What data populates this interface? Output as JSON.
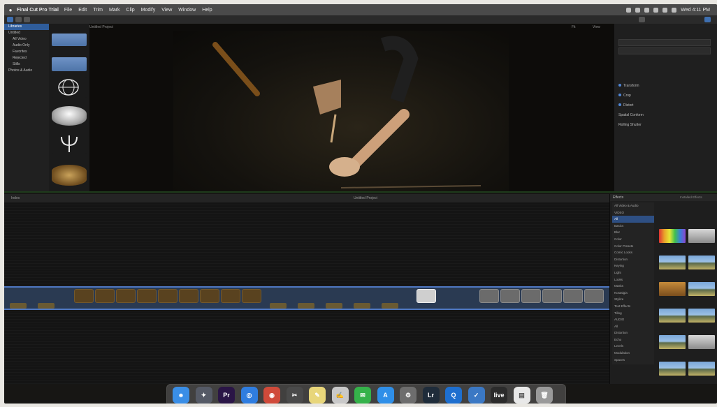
{
  "menubar": {
    "apple": "",
    "app_name": "Final Cut Pro Trial",
    "items": [
      "File",
      "Edit",
      "Trim",
      "Mark",
      "Clip",
      "Modify",
      "View",
      "Window",
      "Help"
    ],
    "clock": "Wed 4:11 PM"
  },
  "libraries": {
    "items": [
      "Libraries",
      "Untitled",
      "All Video",
      "Audio Only",
      "Favorites",
      "Rejected",
      "Stills",
      "Photos & Audio"
    ]
  },
  "viewer": {
    "title": "Untitled Project",
    "zoom": "Fit",
    "view_label": "View"
  },
  "inspector": {
    "rows": [
      "Transform",
      "Crop",
      "Distort",
      "Spatial Conform",
      "Rolling Shutter"
    ]
  },
  "timeline": {
    "index_label": "Index",
    "project_label": "Untitled Project"
  },
  "effects": {
    "header": "Effects",
    "search_placeholder": "Search",
    "categories": [
      "All Video & Audio",
      "VIDEO",
      "All",
      "Basics",
      "Blur",
      "Color",
      "Color Presets",
      "Comic Looks",
      "Distortion",
      "Keying",
      "Light",
      "Looks",
      "Masks",
      "Nostalgia",
      "Stylize",
      "Text Effects",
      "Tiling",
      "AUDIO",
      "All",
      "Distortion",
      "Echo",
      "Levels",
      "Modulation",
      "Spaces"
    ],
    "installed_label": "Installed Effects"
  },
  "dock": {
    "apps": [
      {
        "name": "finder-icon",
        "glyph": "☻",
        "color": "#3a8ee6"
      },
      {
        "name": "launchpad-icon",
        "glyph": "✦",
        "color": "#555a66"
      },
      {
        "name": "premiere-icon",
        "glyph": "Pr",
        "color": "#2a1546"
      },
      {
        "name": "safari-icon",
        "glyph": "◎",
        "color": "#2f7de0"
      },
      {
        "name": "chrome-icon",
        "glyph": "◉",
        "color": "#d04a3a"
      },
      {
        "name": "final-cut-icon",
        "glyph": "✂",
        "color": "#4a4a4a"
      },
      {
        "name": "notes-icon",
        "glyph": "✎",
        "color": "#e8d67a"
      },
      {
        "name": "text-editor-icon",
        "glyph": "✍",
        "color": "#c9c9c9"
      },
      {
        "name": "line-icon",
        "glyph": "✉",
        "color": "#35b24a"
      },
      {
        "name": "app-store-icon",
        "glyph": "A",
        "color": "#2f8fe8"
      },
      {
        "name": "system-preferences-icon",
        "glyph": "⚙",
        "color": "#6d6d6d"
      },
      {
        "name": "lightroom-icon",
        "glyph": "Lr",
        "color": "#1f2c3a"
      },
      {
        "name": "quicktime-icon",
        "glyph": "Q",
        "color": "#1e6fcf"
      },
      {
        "name": "security-icon",
        "glyph": "✓",
        "color": "#3b78c4"
      },
      {
        "name": "ableton-live-icon",
        "glyph": "live",
        "color": "#2b2b2b"
      },
      {
        "name": "document-icon",
        "glyph": "▤",
        "color": "#e8e8e8"
      },
      {
        "name": "trash-icon",
        "glyph": "🗑",
        "color": "#9a9a9a"
      }
    ]
  }
}
